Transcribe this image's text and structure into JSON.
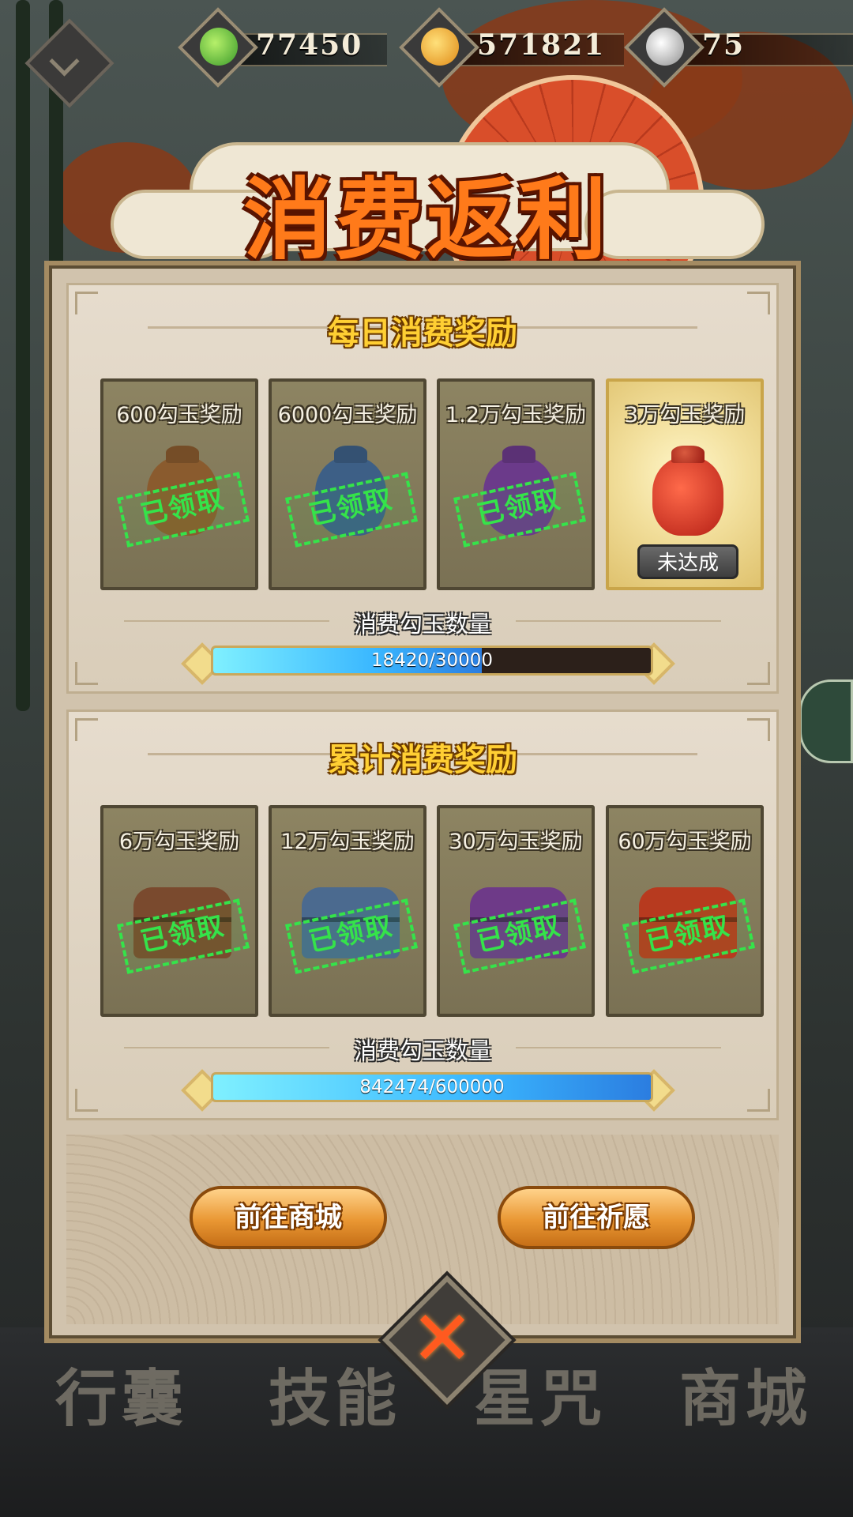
{
  "resources": [
    {
      "icon": "green-magatama-icon",
      "value": "77450",
      "color": "#4fb33a"
    },
    {
      "icon": "gold-coin-icon",
      "value": "571821",
      "color": "#f1a92b"
    },
    {
      "icon": "silver-orb-icon",
      "value": "75",
      "color": "#c9c9c9"
    }
  ],
  "title": "消费返利",
  "daily": {
    "title": "每日消费奖励",
    "cards": [
      {
        "label": "600勾玉奖励",
        "status": "已领取",
        "icon": "brown-pouch-icon",
        "color": "#8a5b2e"
      },
      {
        "label": "6000勾玉奖励",
        "status": "已领取",
        "icon": "blue-pouch-icon",
        "color": "#3d5f86"
      },
      {
        "label": "1.2万勾玉奖励",
        "status": "已领取",
        "icon": "purple-pouch-icon",
        "color": "#6b3a8a"
      },
      {
        "label": "3万勾玉奖励",
        "status": "未达成",
        "icon": "red-pouch-icon",
        "color": "#d43a2a"
      }
    ],
    "qty_label": "消费勾玉数量",
    "progress_text": "18420/30000",
    "progress": 0.614
  },
  "cumulative": {
    "title": "累计消费奖励",
    "cards": [
      {
        "label": "6万勾玉奖励",
        "status": "已领取",
        "icon": "brown-chest-icon",
        "color": "#7a4a2e"
      },
      {
        "label": "12万勾玉奖励",
        "status": "已领取",
        "icon": "blue-chest-icon",
        "color": "#4b6a8f"
      },
      {
        "label": "30万勾玉奖励",
        "status": "已领取",
        "icon": "purple-chest-icon",
        "color": "#6e3a88"
      },
      {
        "label": "60万勾玉奖励",
        "status": "已领取",
        "icon": "red-chest-icon",
        "color": "#b73a1f"
      }
    ],
    "qty_label": "消费勾玉数量",
    "progress_text": "842474/600000",
    "progress": 1.0
  },
  "buttons": {
    "shop": "前往商城",
    "wish": "前往祈愿"
  },
  "background_tabs": [
    "行囊",
    "技能",
    "星咒",
    "商城"
  ]
}
